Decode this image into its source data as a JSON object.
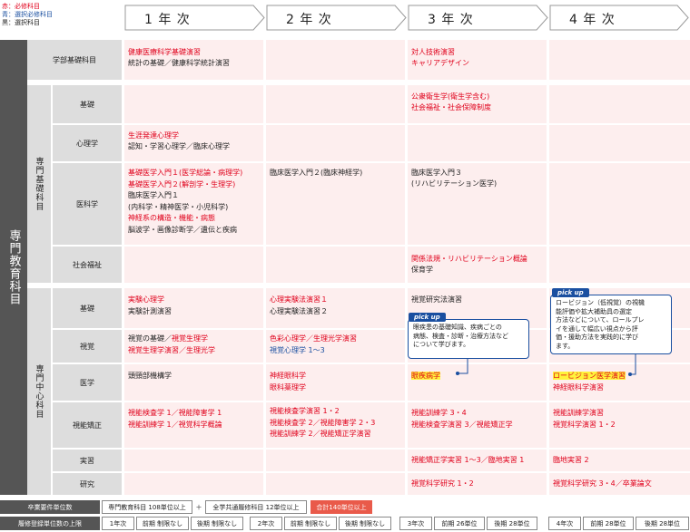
{
  "legend": {
    "red": "赤：必修科目",
    "blue": "青：選択必修科目",
    "black": "黒：選択科目"
  },
  "years": [
    "1 年 次",
    "2 年 次",
    "3 年 次",
    "4 年 次"
  ],
  "category_main": "専門教育科目",
  "group_basic": "専門基礎科目",
  "group_core": "専門中心科目",
  "rows": {
    "faculty": {
      "label": "学部基礎科目",
      "y1": [
        "健康医療科学基礎演習",
        "統計の基礎／健康科学統計演習"
      ],
      "y3": [
        "対人技術演習",
        "キャリアデザイン"
      ]
    },
    "kiso1": {
      "label": "基礎",
      "y3": [
        "公衆衛生学(衛生学含む)",
        "社会福祉・社会保障制度"
      ]
    },
    "psych": {
      "label": "心理学",
      "y1": [
        "生涯発達心理学",
        "認知・学習心理学／臨床心理学"
      ]
    },
    "medical": {
      "label": "医科学",
      "y1": [
        "基礎医学入門１(医学総論・病理学)",
        "基礎医学入門２(解剖学・生理学)",
        "臨床医学入門１",
        "(内科学・精神医学・小児科学)",
        "神経系の構造・機能・病態",
        "脳波学・画像診断学／遺伝と疾病"
      ],
      "y2": [
        "臨床医学入門２(臨床神経学)"
      ],
      "y3": [
        "臨床医学入門３",
        "(リハビリテーション医学)"
      ]
    },
    "welfare": {
      "label": "社会福祉",
      "y3": [
        "関係法規・リハビリテーション概論",
        "保育学"
      ]
    },
    "kiso2": {
      "label": "基礎",
      "y1": [
        "実験心理学",
        "実験計測演習"
      ],
      "y2": [
        "心理実験法演習１",
        "心理実験法演習２"
      ],
      "y3": [
        "視覚研究法演習"
      ]
    },
    "vision": {
      "label": "視覚",
      "y1a": "視覚の基礎",
      "y1b": "視覚生理学",
      "y1c": "視覚生理学演習",
      "y1d": "生理光学",
      "y2a": "色彩心理学",
      "y2b": "生理光学演習",
      "y2c": "視覚心理学 1〜3"
    },
    "medicine": {
      "label": "医学",
      "y1": [
        "頭頸部機構学"
      ],
      "y2": [
        "神経眼科学",
        "眼科薬理学"
      ],
      "y3": "眼疾病学",
      "y4a": "ロービジョン医学演習",
      "y4b": "神経眼科学演習"
    },
    "ortho": {
      "label": "視能矯正",
      "y1": [
        "視能検査学 1／視能障害学 1",
        "視能訓練学 1／視覚科学概論"
      ],
      "y2": [
        "視能検査学演習 1・2",
        "視能検査学 2／視能障害学 2・3",
        "視能訓練学 2／視能矯正学演習"
      ],
      "y3": [
        "視能訓練学 3・4",
        "視能検査学演習 3／視能矯正学"
      ],
      "y4": [
        "視能訓練学演習",
        "視覚科学演習 1・2"
      ]
    },
    "practice": {
      "label": "実習",
      "y3": "視能矯正学実習 1〜3／臨地実習 1",
      "y4": "臨地実習 2"
    },
    "research": {
      "label": "研究",
      "y3": "視覚科学研究 1・2",
      "y4": "視覚科学研究 3・4／卒業論文"
    }
  },
  "pickups": {
    "tag": "pick up",
    "p1": [
      "眼疾患の基礎知識、疾病ごとの",
      "病態、検査・診断・治療方法など",
      "について学びます。"
    ],
    "p2": [
      "ロービジョン（低視覚）の視機",
      "能評価や拡大補助具の選定",
      "方法などについて、ロールプレ",
      "イを通して幅広い視点から評",
      "価・援助方法を実践的に学び",
      "ます。"
    ]
  },
  "footer": {
    "req_label": "卒業要件単位数",
    "req1": "専門教育科目 108単位以上",
    "plus": "＋",
    "req2": "全学共通履修科目 12単位以上",
    "total": "合計140単位以上",
    "cap_label": "履修登録単位数の上限",
    "caps": [
      [
        "1年次",
        "前期 制限なし",
        "後期 制限なし"
      ],
      [
        "2年次",
        "前期 制限なし",
        "後期 制限なし"
      ],
      [
        "3年次",
        "前期 26単位",
        "後期 28単位"
      ],
      [
        "4年次",
        "前期 28単位",
        "後期 28単位"
      ]
    ]
  }
}
